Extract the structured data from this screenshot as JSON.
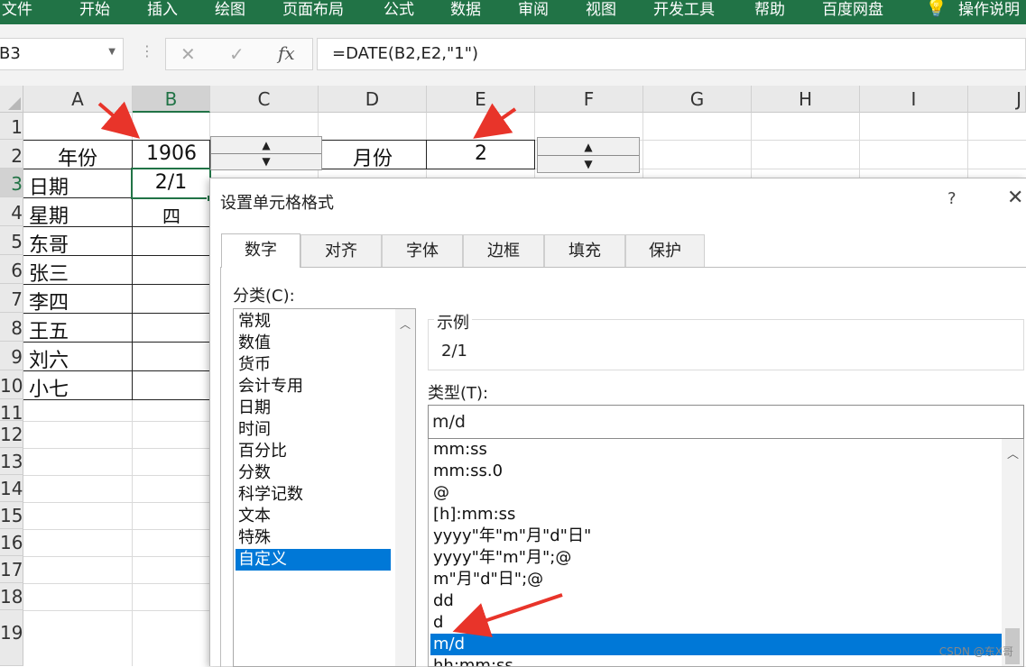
{
  "ribbon": {
    "tabs": [
      "文件",
      "开始",
      "插入",
      "绘图",
      "页面布局",
      "公式",
      "数据",
      "审阅",
      "视图",
      "开发工具",
      "帮助",
      "百度网盘",
      "操作说明"
    ]
  },
  "formula_bar": {
    "name_box": "B3",
    "cancel_symbol": "✕",
    "enter_symbol": "✓",
    "fx_symbol": "fx",
    "formula": "=DATE(B2,E2,\"1\")"
  },
  "columns": [
    "A",
    "B",
    "C",
    "D",
    "E",
    "F",
    "G",
    "H",
    "I",
    "J"
  ],
  "rows": [
    "1",
    "2",
    "3",
    "4",
    "5",
    "6",
    "7",
    "8",
    "9",
    "10",
    "11",
    "12",
    "13",
    "14",
    "15",
    "16",
    "17",
    "18",
    "19"
  ],
  "cells": {
    "A2": "年份",
    "B2": "1906",
    "D2": "月份",
    "E2": "2",
    "A3": "日期",
    "B3": "2/1",
    "A4": "星期",
    "B4": "四",
    "A5": "东哥",
    "A6": "张三",
    "A7": "李四",
    "A8": "王五",
    "A9": "刘六",
    "A10": "小七"
  },
  "dialog": {
    "title": "设置单元格格式",
    "help": "?",
    "close": "✕",
    "tabs": [
      "数字",
      "对齐",
      "字体",
      "边框",
      "填充",
      "保护"
    ],
    "category_label": "分类(C):",
    "categories": [
      "常规",
      "数值",
      "货币",
      "会计专用",
      "日期",
      "时间",
      "百分比",
      "分数",
      "科学记数",
      "文本",
      "特殊",
      "自定义"
    ],
    "selected_category": "自定义",
    "sample_label": "示例",
    "sample_value": "2/1",
    "type_label": "类型(T):",
    "type_value": "m/d",
    "type_list": [
      "mm:ss",
      "mm:ss.0",
      "@",
      "[h]:mm:ss",
      "yyyy\"年\"m\"月\"d\"日\"",
      "yyyy\"年\"m\"月\";@",
      "m\"月\"d\"日\";@",
      "dd",
      "d",
      "m/d",
      "hh:mm:ss"
    ],
    "selected_type": "m/d"
  },
  "watermark": "CSDN @东X哥",
  "colors": {
    "ribbon": "#217346",
    "selection": "#0078d7",
    "arrow": "#e8342a"
  }
}
